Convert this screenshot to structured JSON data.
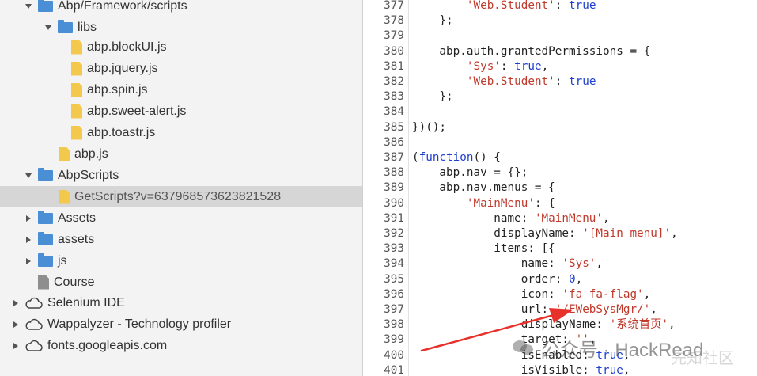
{
  "file_tree": [
    {
      "label": "Abp/Framework/scripts",
      "type": "folder",
      "expanded": true
    },
    {
      "label": "libs",
      "type": "folder",
      "expanded": true
    },
    {
      "label": "abp.blockUI.js",
      "type": "file"
    },
    {
      "label": "abp.jquery.js",
      "type": "file"
    },
    {
      "label": "abp.spin.js",
      "type": "file"
    },
    {
      "label": "abp.sweet-alert.js",
      "type": "file"
    },
    {
      "label": "abp.toastr.js",
      "type": "file"
    },
    {
      "label": "abp.js",
      "type": "file"
    },
    {
      "label": "AbpScripts",
      "type": "folder",
      "expanded": true
    },
    {
      "label": "GetScripts?v=637968573623821528",
      "type": "file",
      "selected": true
    },
    {
      "label": "Assets",
      "type": "folder",
      "expanded": false
    },
    {
      "label": "assets",
      "type": "folder",
      "expanded": false
    },
    {
      "label": "js",
      "type": "folder",
      "expanded": false
    },
    {
      "label": "Course",
      "type": "file-gray"
    },
    {
      "label": "Selenium IDE",
      "type": "cloud",
      "expanded": false
    },
    {
      "label": "Wappalyzer - Technology profiler",
      "type": "cloud",
      "expanded": false
    },
    {
      "label": "fonts.googleapis.com",
      "type": "cloud",
      "expanded": false
    }
  ],
  "code_lines": [
    {
      "num": "377",
      "segments": [
        [
          "        ",
          ""
        ],
        [
          "'Web.Student'",
          "str"
        ],
        [
          ": ",
          ""
        ],
        [
          "true",
          "kw"
        ]
      ]
    },
    {
      "num": "378",
      "segments": [
        [
          "    };",
          ""
        ]
      ]
    },
    {
      "num": "379",
      "segments": [
        [
          "",
          ""
        ]
      ]
    },
    {
      "num": "380",
      "segments": [
        [
          "    abp.auth.grantedPermissions = {",
          ""
        ]
      ]
    },
    {
      "num": "381",
      "segments": [
        [
          "        ",
          ""
        ],
        [
          "'Sys'",
          "str"
        ],
        [
          ": ",
          ""
        ],
        [
          "true",
          "kw"
        ],
        [
          ",",
          ""
        ]
      ]
    },
    {
      "num": "382",
      "segments": [
        [
          "        ",
          ""
        ],
        [
          "'Web.Student'",
          "str"
        ],
        [
          ": ",
          ""
        ],
        [
          "true",
          "kw"
        ]
      ]
    },
    {
      "num": "383",
      "segments": [
        [
          "    };",
          ""
        ]
      ]
    },
    {
      "num": "384",
      "segments": [
        [
          "",
          ""
        ]
      ]
    },
    {
      "num": "385",
      "segments": [
        [
          "})();",
          ""
        ]
      ]
    },
    {
      "num": "386",
      "segments": [
        [
          "",
          ""
        ]
      ]
    },
    {
      "num": "387",
      "segments": [
        [
          "(",
          ""
        ],
        [
          "function",
          "kw"
        ],
        [
          "() {",
          ""
        ]
      ]
    },
    {
      "num": "388",
      "segments": [
        [
          "    abp.nav = {};",
          ""
        ]
      ]
    },
    {
      "num": "389",
      "segments": [
        [
          "    abp.nav.menus = {",
          ""
        ]
      ]
    },
    {
      "num": "390",
      "segments": [
        [
          "        ",
          ""
        ],
        [
          "'MainMenu'",
          "str"
        ],
        [
          ": {",
          ""
        ]
      ]
    },
    {
      "num": "391",
      "segments": [
        [
          "            name: ",
          ""
        ],
        [
          "'MainMenu'",
          "str"
        ],
        [
          ",",
          ""
        ]
      ]
    },
    {
      "num": "392",
      "segments": [
        [
          "            displayName: ",
          ""
        ],
        [
          "'[Main menu]'",
          "str"
        ],
        [
          ",",
          ""
        ]
      ]
    },
    {
      "num": "393",
      "segments": [
        [
          "            items: [{",
          ""
        ]
      ]
    },
    {
      "num": "394",
      "segments": [
        [
          "                name: ",
          ""
        ],
        [
          "'Sys'",
          "str"
        ],
        [
          ",",
          ""
        ]
      ]
    },
    {
      "num": "395",
      "segments": [
        [
          "                order: ",
          ""
        ],
        [
          "0",
          "num"
        ],
        [
          ",",
          ""
        ]
      ]
    },
    {
      "num": "396",
      "segments": [
        [
          "                icon: ",
          ""
        ],
        [
          "'fa fa-flag'",
          "str"
        ],
        [
          ",",
          ""
        ]
      ]
    },
    {
      "num": "397",
      "segments": [
        [
          "                url: ",
          ""
        ],
        [
          "'/EWebSysMgr/'",
          "str"
        ],
        [
          ",",
          ""
        ]
      ]
    },
    {
      "num": "398",
      "segments": [
        [
          "                displayName: ",
          ""
        ],
        [
          "'系统首页'",
          "str"
        ],
        [
          ",",
          ""
        ]
      ]
    },
    {
      "num": "399",
      "segments": [
        [
          "                target: ",
          ""
        ],
        [
          "''",
          "str"
        ],
        [
          ",",
          ""
        ]
      ]
    },
    {
      "num": "400",
      "segments": [
        [
          "                isEnabled: ",
          ""
        ],
        [
          "true",
          "kw"
        ],
        [
          ",",
          ""
        ]
      ]
    },
    {
      "num": "401",
      "segments": [
        [
          "                isVisible: ",
          ""
        ],
        [
          "true",
          "kw"
        ],
        [
          ",",
          ""
        ]
      ]
    }
  ],
  "watermark": {
    "text": "公众号 · HackRead",
    "faint": "先知社区"
  },
  "colors": {
    "string": "#c0392b",
    "keyword": "#1f3fd1",
    "folder": "#4a8fd6",
    "file": "#f2c94c",
    "arrow": "#e8312a"
  }
}
